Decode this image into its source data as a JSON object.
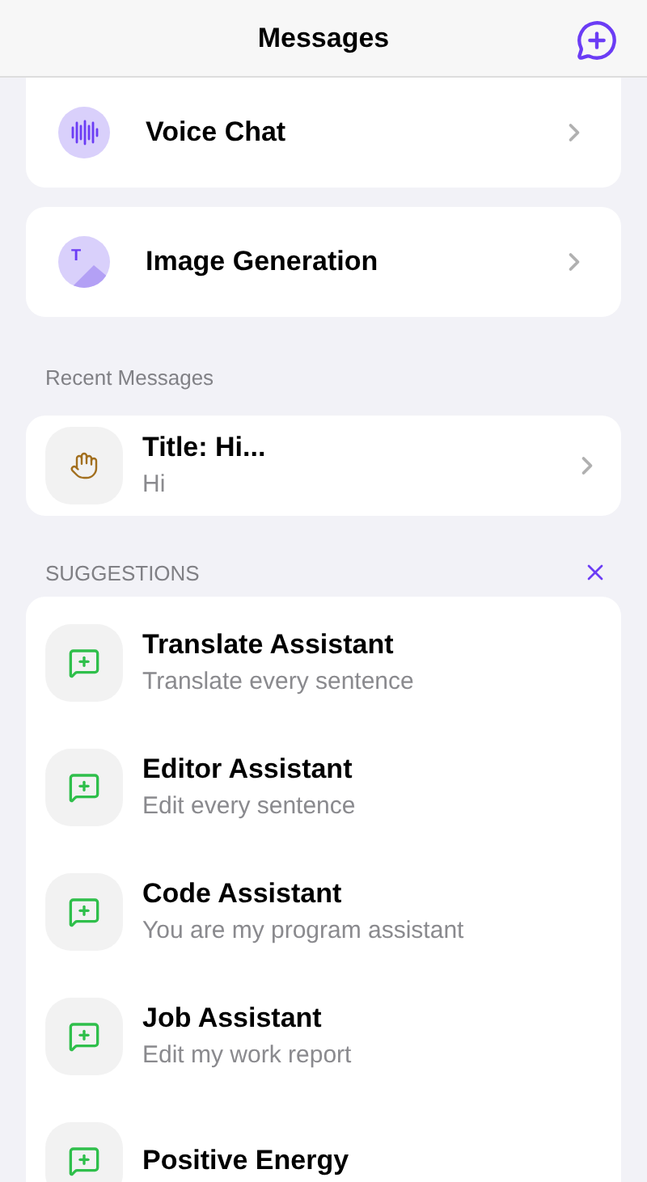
{
  "header": {
    "title": "Messages"
  },
  "features": [
    {
      "kind": "voice",
      "label": "Voice Chat"
    },
    {
      "kind": "image",
      "label": "Image Generation",
      "icon_letter": "T"
    }
  ],
  "recent": {
    "heading": "Recent Messages",
    "items": [
      {
        "title": "Title: Hi...",
        "preview": "Hi"
      }
    ]
  },
  "suggestions": {
    "heading": "SUGGESTIONS",
    "items": [
      {
        "title": "Translate Assistant",
        "subtitle": "Translate every sentence"
      },
      {
        "title": "Editor Assistant",
        "subtitle": "Edit every sentence"
      },
      {
        "title": "Code Assistant",
        "subtitle": "You are my program assistant"
      },
      {
        "title": "Job Assistant",
        "subtitle": "Edit my work report"
      },
      {
        "title": "Positive Energy"
      }
    ]
  }
}
